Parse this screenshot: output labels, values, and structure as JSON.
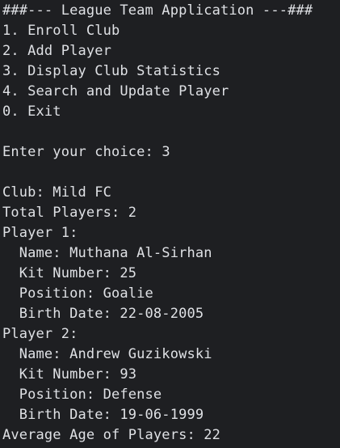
{
  "console": {
    "menu": {
      "header": "###--- League Team Application ---###",
      "options": [
        "1. Enroll Club",
        "2. Add Player",
        "3. Display Club Statistics",
        "4. Search and Update Player",
        "0. Exit"
      ]
    },
    "prompt": {
      "text": "Enter your choice: ",
      "input": "3"
    },
    "club": {
      "label": "Club: Mild FC",
      "total_players": "Total Players: 2"
    },
    "players": [
      {
        "heading": "Player 1:",
        "name": "  Name: Muthana Al-Sirhan",
        "kit": "  Kit Number: 25",
        "position": "  Position: Goalie",
        "birth": "  Birth Date: 22-08-2005"
      },
      {
        "heading": "Player 2:",
        "name": "  Name: Andrew Guzikowski",
        "kit": "  Kit Number: 93",
        "position": "  Position: Defense",
        "birth": "  Birth Date: 19-06-1999"
      }
    ],
    "average_age": "Average Age of Players: 22"
  }
}
